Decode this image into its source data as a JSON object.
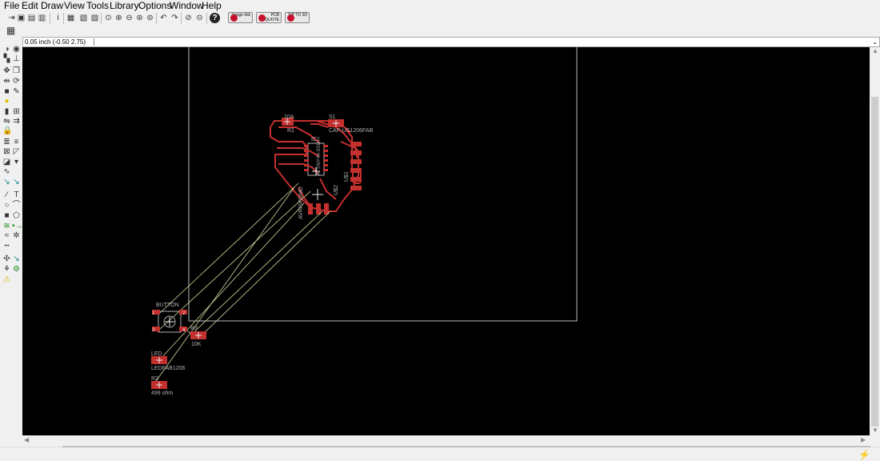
{
  "menu": {
    "file": "File",
    "edit": "Edit",
    "draw": "Draw",
    "view": "View",
    "tools": "Tools",
    "library": "Library",
    "options": "Options",
    "window": "Window",
    "help": "Help"
  },
  "toolbar": {
    "promo1": "design link",
    "promo2": "PCB QUOTE",
    "promo3": "SIP TO 3D"
  },
  "command_line": {
    "coordinates": "0.05 inch (-0.50 2.75)",
    "input_value": ""
  },
  "board": {
    "components": {
      "r1_value": "10A",
      "r1_name": "R1",
      "s1_name": "S1",
      "s1_value": "CAP-US1206FAB",
      "ic1_name": "IC1",
      "ic1_value": "ATTINY44-SSU",
      "avrisp_label": "AVRISPSMD",
      "u1_label": "U$1",
      "u2_label": "U$2",
      "button_name": "BUTTON",
      "pin1": "1",
      "pin2": "2",
      "pin3": "3",
      "pin4": "4",
      "r3_name": "R3",
      "r3_value": "10K",
      "led_name": "LED",
      "led_value": "LEDFAB1206",
      "r2_name": "R2",
      "r2_value": "499 ohm"
    }
  },
  "colors": {
    "canvas_bg": "#000000",
    "copper": "#c4302e",
    "airwire": "#d7d7a0",
    "outline": "#bdbdbd",
    "silkscreen": "#b0b0b0"
  }
}
